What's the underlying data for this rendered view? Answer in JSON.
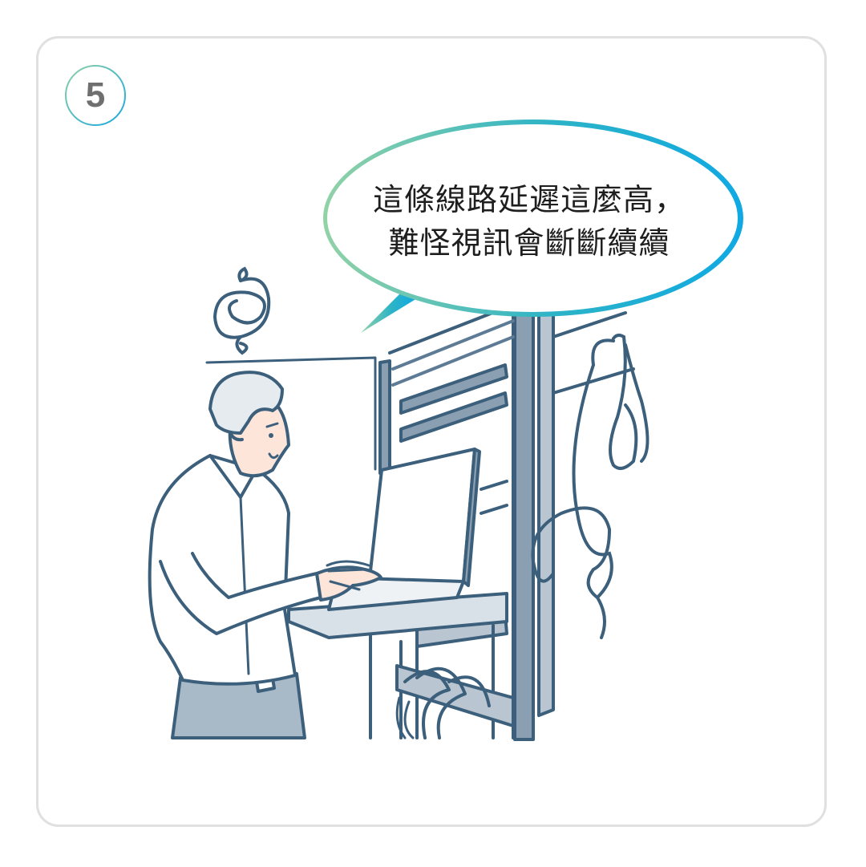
{
  "step": {
    "number": "5"
  },
  "speech_bubble": {
    "line1": "這條線路延遲這麼高，",
    "line2": "難怪視訊會斷斷續續"
  },
  "colors": {
    "badge_gradient_start": "#8fd0a4",
    "badge_gradient_end": "#1aa7e0",
    "bubble_gradient_start": "#92d2a6",
    "bubble_gradient_end": "#10a9e3",
    "line_art": "#3c5f7c",
    "rack_fill": "#8aa0b2"
  },
  "icons": [
    "confused-scribble-icon"
  ]
}
